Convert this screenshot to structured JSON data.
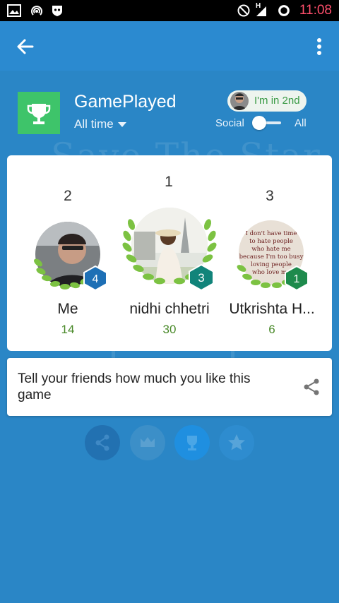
{
  "status_bar": {
    "time": "11:08",
    "network_label": "H"
  },
  "header": {
    "game_title": "GamePlayed",
    "time_filter": "All time",
    "rank_badge": "I'm in 2nd",
    "toggle_left": "Social",
    "toggle_right": "All"
  },
  "background_title": "Save The Star",
  "podium": [
    {
      "rank": "2",
      "name": "Me",
      "score": "14",
      "level": "4",
      "level_color": "#1d6fb5"
    },
    {
      "rank": "1",
      "name": "nidhi chhetri",
      "score": "30",
      "level": "3",
      "level_color": "#11847a"
    },
    {
      "rank": "3",
      "name": "Utkrishta H...",
      "score": "6",
      "level": "1",
      "level_color": "#1e8a4c"
    }
  ],
  "avatar_quote": "I don't have time to hate people who hate me because I'm too busy loving people who love me",
  "share_prompt": "Tell your friends how much you like this game",
  "colors": {
    "app_bar": "#2b8ad0",
    "background": "#2a86c6",
    "trophy_tile": "#3ec46a",
    "laurel": "#7cc242"
  },
  "bottom_actions": [
    {
      "icon": "share-icon",
      "color": "#2271b1"
    },
    {
      "icon": "crown-icon",
      "color": "#3c8fc8"
    },
    {
      "icon": "trophy-icon",
      "color": "#1f8fe0"
    },
    {
      "icon": "star-icon",
      "color": "#2e8ccf"
    }
  ]
}
